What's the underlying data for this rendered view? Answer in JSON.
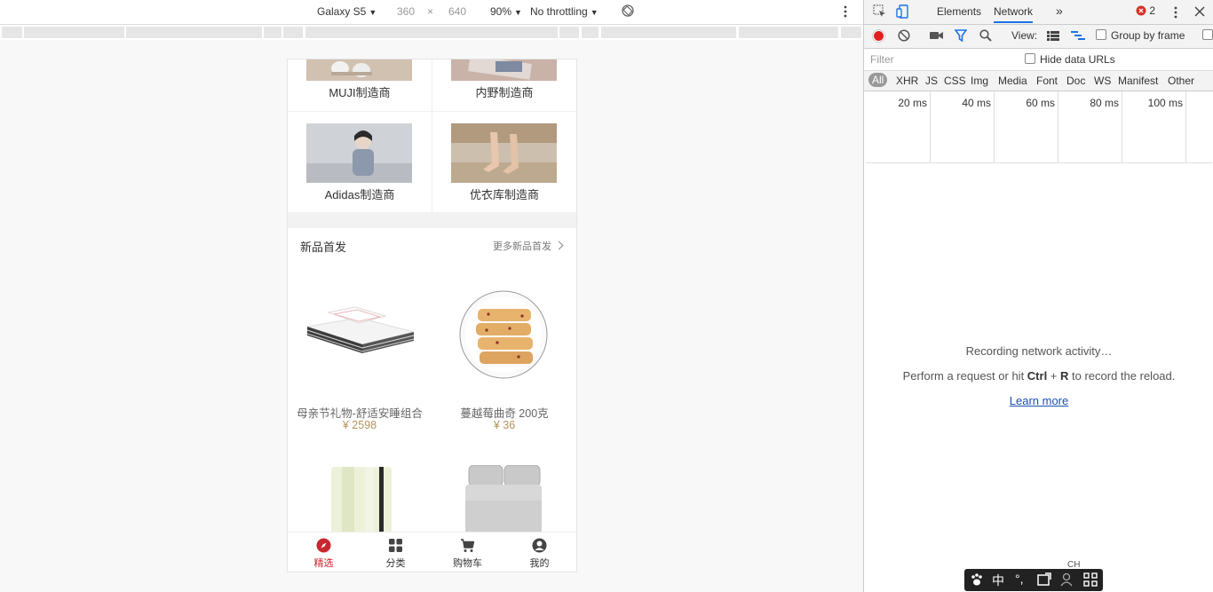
{
  "device_toolbar": {
    "device": "Galaxy S5",
    "width": "360",
    "times": "×",
    "height": "640",
    "zoom": "90%",
    "throttling": "No throttling"
  },
  "brands": [
    {
      "label": "MUJI制造商"
    },
    {
      "label": "内野制造商"
    },
    {
      "label": "Adidas制造商"
    },
    {
      "label": "优衣库制造商"
    }
  ],
  "new_arrivals": {
    "title": "新品首发",
    "more": "更多新品首发",
    "products": [
      {
        "name": "母亲节礼物-舒适安睡组合",
        "price": "¥ 2598"
      },
      {
        "name": "蔓越莓曲奇 200克",
        "price": "¥ 36"
      }
    ]
  },
  "tabbar": [
    {
      "label": "精选",
      "active": true
    },
    {
      "label": "分类",
      "active": false
    },
    {
      "label": "购物车",
      "active": false
    },
    {
      "label": "我的",
      "active": false
    }
  ],
  "devtools": {
    "tabs": {
      "elements": "Elements",
      "network": "Network",
      "more": "»"
    },
    "error_count": "2",
    "toolbar": {
      "view": "View:",
      "group_by_frame": "Group by frame"
    },
    "filter_placeholder": "Filter",
    "hide_data_urls": "Hide data URLs",
    "types": [
      "All",
      "XHR",
      "JS",
      "CSS",
      "Img",
      "Media",
      "Font",
      "Doc",
      "WS",
      "Manifest",
      "Other"
    ],
    "timeline": [
      "20 ms",
      "40 ms",
      "60 ms",
      "80 ms",
      "100 ms"
    ],
    "empty": {
      "line1": "Recording network activity…",
      "line2_pre": "Perform a request or hit ",
      "ctrl": "Ctrl",
      "plus": " + ",
      "r": "R",
      "line2_post": " to record the reload.",
      "learn_more": "Learn more"
    }
  },
  "ime": {
    "lang": "中",
    "punct": "°,",
    "ch": "CH"
  },
  "colors": {
    "accent_red": "#c8272f",
    "price": "#b4935a",
    "link": "#1a4fb5",
    "record": "#e0201e",
    "active_tab_underline": "#1a73e8"
  }
}
